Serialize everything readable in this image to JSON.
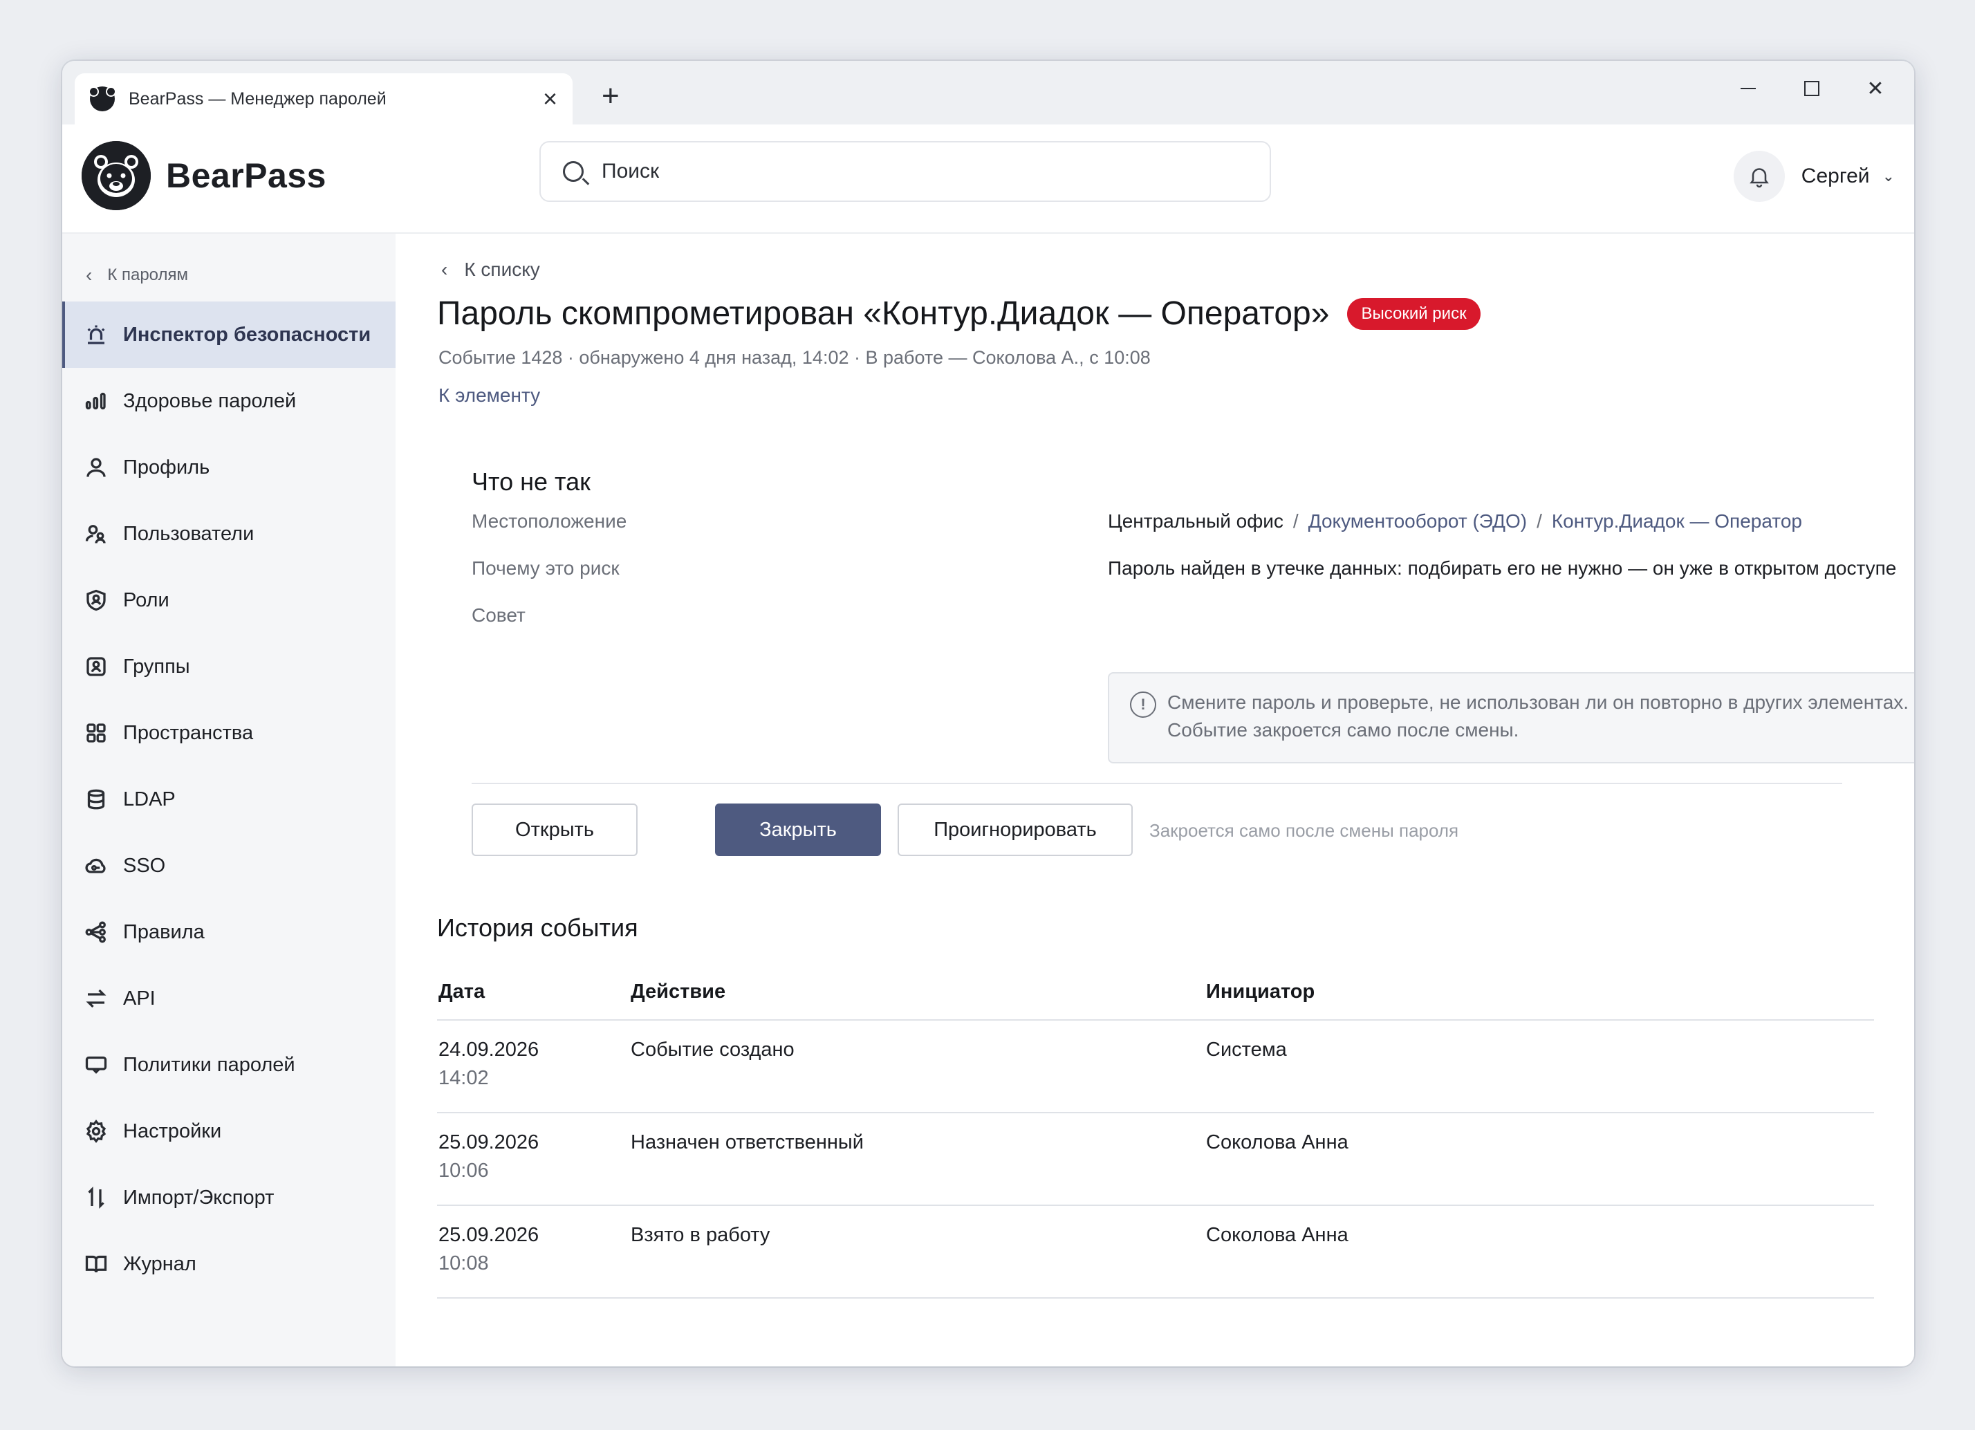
{
  "window": {
    "tab_title": "BearPass — Менеджер паролей",
    "new_tab": "+"
  },
  "header": {
    "brand": "BearPass",
    "search_placeholder": "Поиск",
    "user_name": "Сергей"
  },
  "sidebar": {
    "back_label": "К паролям",
    "items": [
      {
        "label": "Инспектор безопасности",
        "icon": "alarm-icon",
        "active": true
      },
      {
        "label": "Здоровье паролей",
        "icon": "bars-icon"
      },
      {
        "label": "Профиль",
        "icon": "person-icon"
      },
      {
        "label": "Пользователи",
        "icon": "users-icon"
      },
      {
        "label": "Роли",
        "icon": "shield-user-icon"
      },
      {
        "label": "Группы",
        "icon": "group-icon"
      },
      {
        "label": "Пространства",
        "icon": "grid-icon"
      },
      {
        "label": "LDAP",
        "icon": "database-icon"
      },
      {
        "label": "SSO",
        "icon": "cloud-key-icon"
      },
      {
        "label": "Правила",
        "icon": "nodes-icon"
      },
      {
        "label": "API",
        "icon": "swap-icon"
      },
      {
        "label": "Политики паролей",
        "icon": "password-policy-icon"
      },
      {
        "label": "Настройки",
        "icon": "gear-icon"
      },
      {
        "label": "Импорт/Экспорт",
        "icon": "import-export-icon"
      },
      {
        "label": "Журнал",
        "icon": "book-icon"
      }
    ]
  },
  "main": {
    "breadcrumb": "К списку",
    "title": "Пароль скомпрометирован «Контур.Диадок — Оператор»",
    "risk_badge": "Высокий риск",
    "meta": "Событие 1428 · обнаружено 4 дня назад, 14:02 · В работе — Соколова А., с 10:08",
    "to_element": "К элементу",
    "section_title": "Что не так",
    "location_label": "Местоположение",
    "location_path": [
      "Центральный офис",
      "Документооборот (ЭДО)",
      "Контур.Диадок — Оператор"
    ],
    "path_sep": "/",
    "why_label": "Почему это риск",
    "why_value": "Пароль найден в утечке данных: подбирать его не нужно — он уже в открытом доступе",
    "advice_label": "Совет",
    "advice_text": "Смените пароль и проверьте, не использован ли он повторно в других элементах. Событие закроется само после смены.",
    "info_glyph": "!",
    "buttons": {
      "open": "Открыть",
      "close": "Закрыть",
      "ignore": "Проигнорировать"
    },
    "close_hint": "Закроется само после смены пароля",
    "history_title": "История события",
    "history_columns": [
      "Дата",
      "Действие",
      "Инициатор"
    ],
    "history_rows": [
      {
        "date": "24.09.2026",
        "time": "14:02",
        "action": "Событие создано",
        "initiator": "Система"
      },
      {
        "date": "25.09.2026",
        "time": "10:06",
        "action": "Назначен ответственный",
        "initiator": "Соколова Анна"
      },
      {
        "date": "25.09.2026",
        "time": "10:08",
        "action": "Взято в работу",
        "initiator": "Соколова Анна"
      }
    ]
  },
  "colors": {
    "accent": "#4e5a80",
    "risk": "#d8192c",
    "active_bg": "#dde3ef"
  }
}
